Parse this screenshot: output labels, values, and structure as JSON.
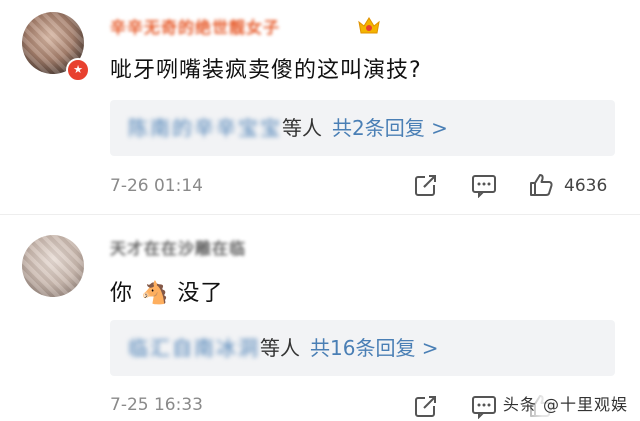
{
  "comments": [
    {
      "username": "辛辛无奇的绝世靓女子",
      "text": "呲牙咧嘴装疯卖傻的这叫演技?",
      "reply_names": "陈南的辛辛宝宝",
      "reply_suffix": "等人",
      "reply_count": "共2条回复 >",
      "timestamp": "7-26 01:14",
      "like_count": "4636",
      "icons": [
        "share-icon",
        "comment-icon",
        "like-icon"
      ]
    },
    {
      "username": "天才在在沙雕在临",
      "text_before": "你",
      "emoji": "🐴",
      "text_after": "没了",
      "reply_names": "临汇自南冰洞",
      "reply_suffix": "等人",
      "reply_count": "共16条回复 >",
      "timestamp": "7-25 16:33",
      "icons": [
        "share-icon",
        "comment-icon",
        "like-icon"
      ]
    }
  ],
  "watermark": "头条 @十里观娱",
  "colors": {
    "username_highlight": "#e65a2a",
    "link_blue": "#4a7fb5",
    "reply_bg": "#f2f3f5",
    "meta_gray": "#8a8a8a"
  }
}
